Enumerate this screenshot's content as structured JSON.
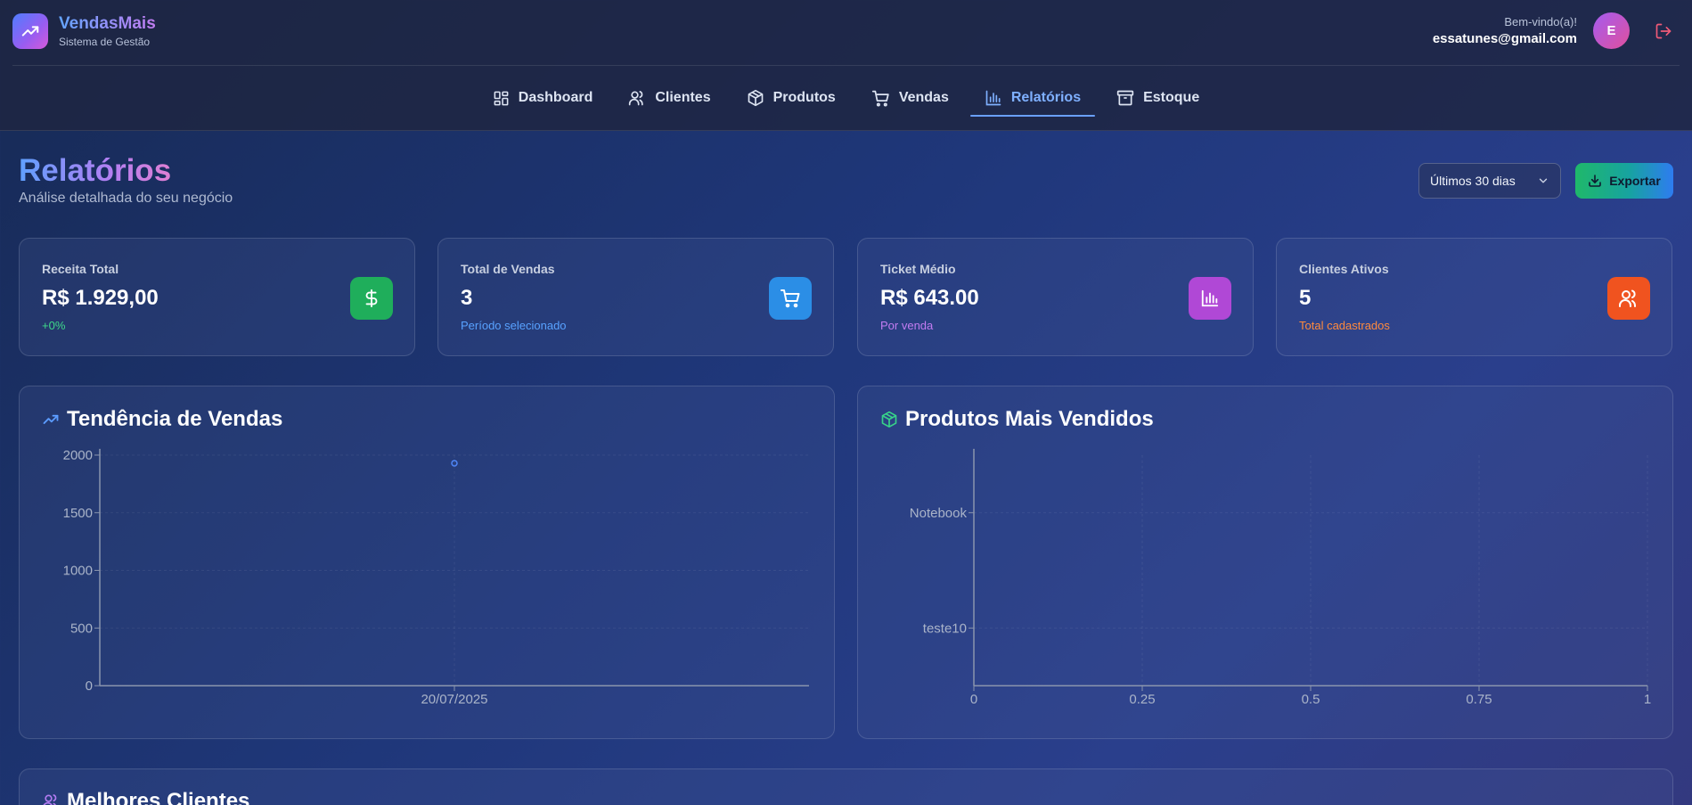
{
  "app": {
    "name": "VendasMais",
    "subtitle": "Sistema de Gestão"
  },
  "user": {
    "welcome": "Bem-vindo(a)!",
    "email": "essatunes@gmail.com",
    "initial": "E"
  },
  "nav": {
    "items": [
      {
        "label": "Dashboard",
        "icon": "dashboard-icon"
      },
      {
        "label": "Clientes",
        "icon": "users-icon"
      },
      {
        "label": "Produtos",
        "icon": "package-icon"
      },
      {
        "label": "Vendas",
        "icon": "cart-icon"
      },
      {
        "label": "Relatórios",
        "icon": "bar-chart-icon",
        "active": true
      },
      {
        "label": "Estoque",
        "icon": "archive-icon"
      }
    ]
  },
  "page": {
    "title": "Relatórios",
    "subtitle": "Análise detalhada do seu negócio"
  },
  "controls": {
    "period": "Últimos 30 dias",
    "export_label": "Exportar"
  },
  "kpis": [
    {
      "label": "Receita Total",
      "value": "R$ 1.929,00",
      "note": "+0%",
      "note_color": "#3fd98a",
      "icon": "dollar-icon",
      "icon_bg": "#1fae5b"
    },
    {
      "label": "Total de Vendas",
      "value": "3",
      "note": "Período selecionado",
      "note_color": "#58a2ff",
      "icon": "cart-icon",
      "icon_bg": "#2b8ee6"
    },
    {
      "label": "Ticket Médio",
      "value": "R$ 643.00",
      "note": "Por venda",
      "note_color": "#c27cf1",
      "icon": "bar-chart-icon",
      "icon_bg": "#b048d6"
    },
    {
      "label": "Clientes Ativos",
      "value": "5",
      "note": "Total cadastrados",
      "note_color": "#ff8a3d",
      "icon": "users-icon",
      "icon_bg": "#f0531f"
    }
  ],
  "charts": {
    "sales_trend_title": "Tendência de Vendas",
    "top_products_title": "Produtos Mais Vendidos"
  },
  "chart_data": [
    {
      "type": "line",
      "title": "Tendência de Vendas",
      "x": [
        "20/07/2025"
      ],
      "series": [
        {
          "values": [
            1929
          ]
        }
      ],
      "ylim": [
        0,
        2000
      ],
      "yticks": [
        0,
        500,
        1000,
        1500,
        2000
      ],
      "grid": true,
      "color": "#4f86f7"
    },
    {
      "type": "bar",
      "orientation": "horizontal",
      "title": "Produtos Mais Vendidos",
      "categories": [
        "Notebook",
        "teste10"
      ],
      "values": [
        0,
        0
      ],
      "xlim": [
        0,
        1
      ],
      "xticks": [
        "0",
        "0.25",
        "0.5",
        "0.75",
        "1"
      ],
      "grid": true
    }
  ],
  "bottom": {
    "title": "Melhores Clientes"
  }
}
